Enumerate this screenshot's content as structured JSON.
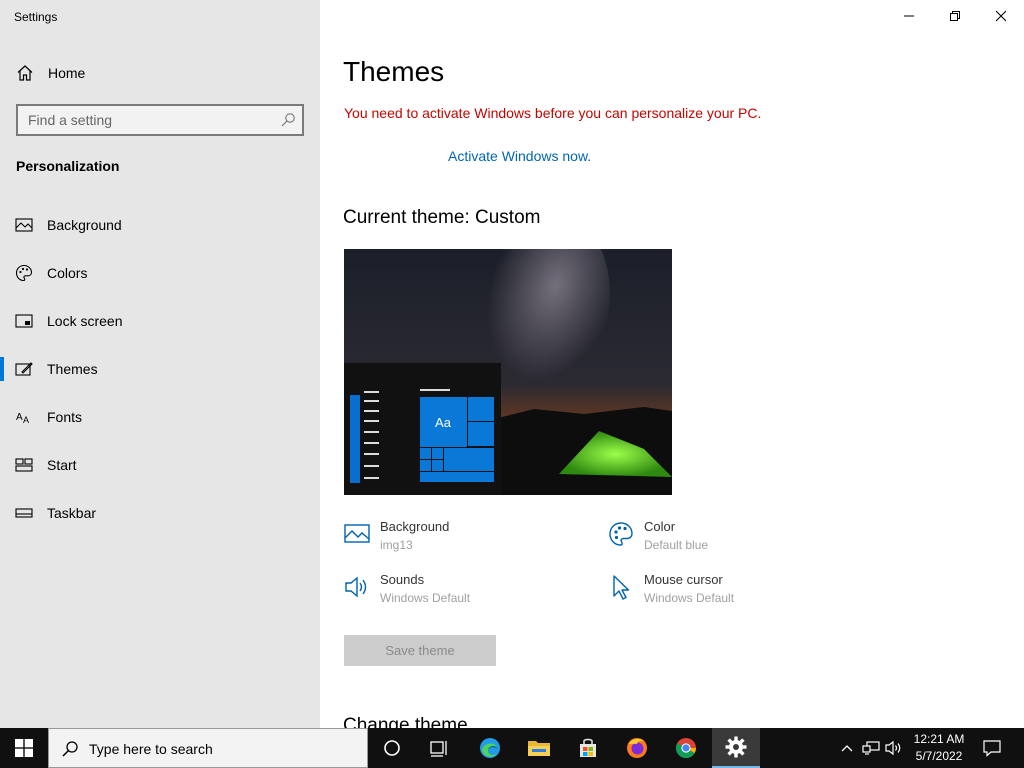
{
  "window": {
    "title": "Settings",
    "controls": {
      "minimize": "minimize",
      "maximize": "restore",
      "close": "close"
    }
  },
  "sidebar": {
    "home_label": "Home",
    "search_placeholder": "Find a setting",
    "section_title": "Personalization",
    "items": [
      {
        "label": "Background",
        "icon": "picture-icon",
        "selected": false
      },
      {
        "label": "Colors",
        "icon": "palette-icon",
        "selected": false
      },
      {
        "label": "Lock screen",
        "icon": "lock-screen-icon",
        "selected": false
      },
      {
        "label": "Themes",
        "icon": "themes-icon",
        "selected": true
      },
      {
        "label": "Fonts",
        "icon": "fonts-icon",
        "selected": false
      },
      {
        "label": "Start",
        "icon": "start-icon",
        "selected": false
      },
      {
        "label": "Taskbar",
        "icon": "taskbar-icon",
        "selected": false
      }
    ]
  },
  "main": {
    "title": "Themes",
    "warning": "You need to activate Windows before you can personalize your PC.",
    "activate_link": "Activate Windows now.",
    "current_theme": "Current theme: Custom",
    "preview_tile_label": "Aa",
    "properties": {
      "background": {
        "label": "Background",
        "value": "img13"
      },
      "color": {
        "label": "Color",
        "value": "Default blue"
      },
      "sounds": {
        "label": "Sounds",
        "value": "Windows Default"
      },
      "mouse_cursor": {
        "label": "Mouse cursor",
        "value": "Windows Default"
      }
    },
    "save_button": "Save theme",
    "change_theme_heading": "Change theme"
  },
  "taskbar": {
    "search_placeholder": "Type here to search",
    "apps": [
      "task-view",
      "edge",
      "file-explorer",
      "store",
      "firefox",
      "chrome",
      "settings"
    ],
    "active_app": "settings",
    "time": "12:21 AM",
    "date": "5/7/2022"
  },
  "colors": {
    "accent": "#0078d7",
    "warning": "#c50500",
    "link": "#0066b4",
    "sidebar_bg": "#e6e6e6",
    "taskbar_bg": "#101010"
  }
}
